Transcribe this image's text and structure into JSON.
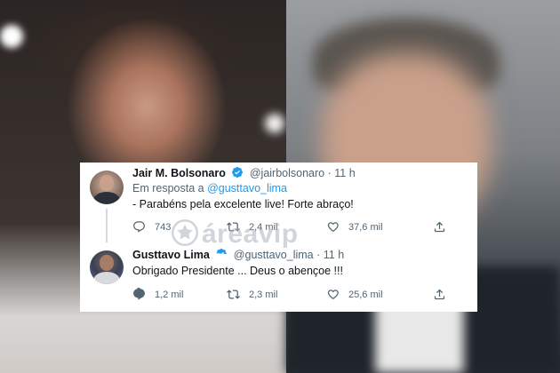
{
  "tweets": [
    {
      "name": "Jair M. Bolsonaro",
      "handle": "@jairbolsonaro",
      "separator": "·",
      "time": "11 h",
      "reply_prefix": "Em resposta a",
      "reply_handle": "@gusttavo_lima",
      "text": "- Parabéns pela excelente live! Forte abraço!",
      "replies": "743",
      "retweets": "2,4 mil",
      "likes": "37,6 mil"
    },
    {
      "name": "Gusttavo Lima",
      "handle": "@gusttavo_lima",
      "separator": "·",
      "time": "11 h",
      "text": "Obrigado Presidente ... Deus o abençoe !!!",
      "replies": "1,2 mil",
      "retweets": "2,3 mil",
      "likes": "25,6 mil"
    }
  ],
  "watermark": "áreavip",
  "colors": {
    "verified": "#1d9bf0",
    "link": "#1d9bf0",
    "muted": "#536471",
    "text": "#0f1419"
  },
  "icons": [
    "verified-badge-icon",
    "reply-icon",
    "retweet-icon",
    "like-icon",
    "share-icon",
    "star-logo-icon"
  ]
}
